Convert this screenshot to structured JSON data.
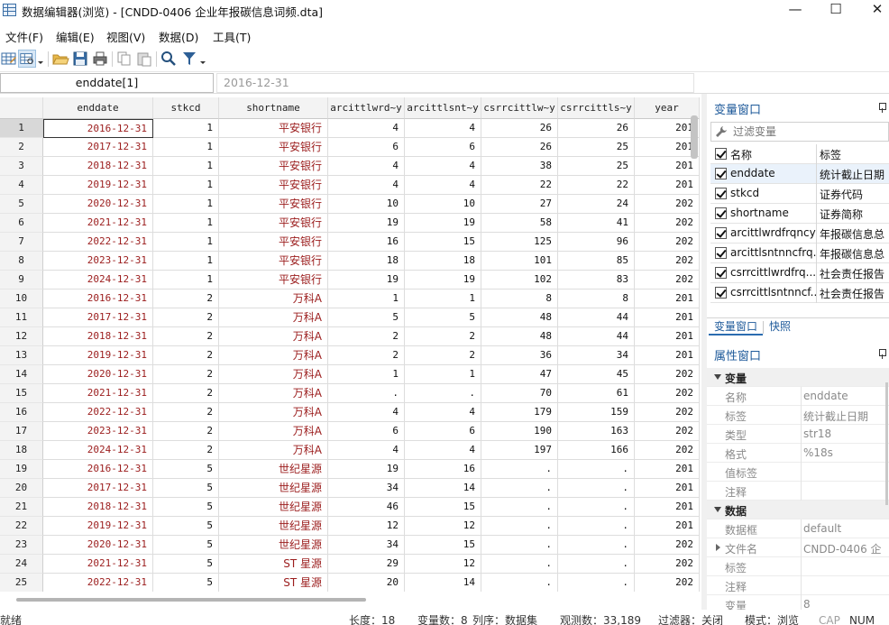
{
  "window": {
    "title": "数据编辑器(浏览) - [CNDD-0406 企业年报碳信息词频.dta]",
    "minimize": "—",
    "maximize": "☐",
    "close": "✕"
  },
  "menu": [
    "文件(F)",
    "编辑(E)",
    "视图(V)",
    "数据(D)",
    "工具(T)"
  ],
  "toolbar": {
    "icons": [
      "table-edit-icon",
      "table-browse-icon",
      "dropdown-arrow-icon",
      "open-folder-icon",
      "save-icon",
      "print-icon",
      "copy-icon",
      "paste-icon",
      "search-icon",
      "filter-icon",
      "dropdown-arrow-icon"
    ]
  },
  "cell_editor": {
    "name": "enddate[1]",
    "value": "2016-12-31"
  },
  "grid": {
    "columns": [
      "enddate",
      "stkcd",
      "shortname",
      "arcittlwrd~y",
      "arcittlsnt~y",
      "csrrcittlw~y",
      "csrrcittls~y",
      "year"
    ],
    "rows": [
      {
        "n": "1",
        "cells": [
          "2016-12-31",
          "1",
          "平安银行",
          "4",
          "4",
          "26",
          "26",
          "201"
        ]
      },
      {
        "n": "2",
        "cells": [
          "2017-12-31",
          "1",
          "平安银行",
          "6",
          "6",
          "26",
          "25",
          "201"
        ]
      },
      {
        "n": "3",
        "cells": [
          "2018-12-31",
          "1",
          "平安银行",
          "4",
          "4",
          "38",
          "25",
          "201"
        ]
      },
      {
        "n": "4",
        "cells": [
          "2019-12-31",
          "1",
          "平安银行",
          "4",
          "4",
          "22",
          "22",
          "201"
        ]
      },
      {
        "n": "5",
        "cells": [
          "2020-12-31",
          "1",
          "平安银行",
          "10",
          "10",
          "27",
          "24",
          "202"
        ]
      },
      {
        "n": "6",
        "cells": [
          "2021-12-31",
          "1",
          "平安银行",
          "19",
          "19",
          "58",
          "41",
          "202"
        ]
      },
      {
        "n": "7",
        "cells": [
          "2022-12-31",
          "1",
          "平安银行",
          "16",
          "15",
          "125",
          "96",
          "202"
        ]
      },
      {
        "n": "8",
        "cells": [
          "2023-12-31",
          "1",
          "平安银行",
          "18",
          "18",
          "101",
          "85",
          "202"
        ]
      },
      {
        "n": "9",
        "cells": [
          "2024-12-31",
          "1",
          "平安银行",
          "19",
          "19",
          "102",
          "83",
          "202"
        ]
      },
      {
        "n": "10",
        "cells": [
          "2016-12-31",
          "2",
          "万科A",
          "1",
          "1",
          "8",
          "8",
          "201"
        ]
      },
      {
        "n": "11",
        "cells": [
          "2017-12-31",
          "2",
          "万科A",
          "5",
          "5",
          "48",
          "44",
          "201"
        ]
      },
      {
        "n": "12",
        "cells": [
          "2018-12-31",
          "2",
          "万科A",
          "2",
          "2",
          "48",
          "44",
          "201"
        ]
      },
      {
        "n": "13",
        "cells": [
          "2019-12-31",
          "2",
          "万科A",
          "2",
          "2",
          "36",
          "34",
          "201"
        ]
      },
      {
        "n": "14",
        "cells": [
          "2020-12-31",
          "2",
          "万科A",
          "1",
          "1",
          "47",
          "45",
          "202"
        ]
      },
      {
        "n": "15",
        "cells": [
          "2021-12-31",
          "2",
          "万科A",
          ".",
          ".",
          "70",
          "61",
          "202"
        ]
      },
      {
        "n": "16",
        "cells": [
          "2022-12-31",
          "2",
          "万科A",
          "4",
          "4",
          "179",
          "159",
          "202"
        ]
      },
      {
        "n": "17",
        "cells": [
          "2023-12-31",
          "2",
          "万科A",
          "6",
          "6",
          "190",
          "163",
          "202"
        ]
      },
      {
        "n": "18",
        "cells": [
          "2024-12-31",
          "2",
          "万科A",
          "4",
          "4",
          "197",
          "166",
          "202"
        ]
      },
      {
        "n": "19",
        "cells": [
          "2016-12-31",
          "5",
          "世纪星源",
          "19",
          "16",
          ".",
          ".",
          "201"
        ]
      },
      {
        "n": "20",
        "cells": [
          "2017-12-31",
          "5",
          "世纪星源",
          "34",
          "14",
          ".",
          ".",
          "201"
        ]
      },
      {
        "n": "21",
        "cells": [
          "2018-12-31",
          "5",
          "世纪星源",
          "46",
          "15",
          ".",
          ".",
          "201"
        ]
      },
      {
        "n": "22",
        "cells": [
          "2019-12-31",
          "5",
          "世纪星源",
          "12",
          "12",
          ".",
          ".",
          "201"
        ]
      },
      {
        "n": "23",
        "cells": [
          "2020-12-31",
          "5",
          "世纪星源",
          "34",
          "15",
          ".",
          ".",
          "202"
        ]
      },
      {
        "n": "24",
        "cells": [
          "2021-12-31",
          "5",
          "ST 星源",
          "29",
          "12",
          ".",
          ".",
          "202"
        ]
      },
      {
        "n": "25",
        "cells": [
          "2022-12-31",
          "5",
          "ST 星源",
          "20",
          "14",
          ".",
          ".",
          "202"
        ]
      }
    ]
  },
  "variables_panel": {
    "title": "变量窗口",
    "filter_placeholder": "过滤变量",
    "header": {
      "name": "名称",
      "label": "标签"
    },
    "items": [
      {
        "name": "enddate",
        "label": "统计截止日期"
      },
      {
        "name": "stkcd",
        "label": "证券代码"
      },
      {
        "name": "shortname",
        "label": "证券简称"
      },
      {
        "name": "arcittlwrdfrqncy",
        "label": "年报碳信息总"
      },
      {
        "name": "arcittlsntnncfrq...",
        "label": "年报碳信息总"
      },
      {
        "name": "csrrcittlwrdfrq...",
        "label": "社会责任报告"
      },
      {
        "name": "csrrcittlsntnncf...",
        "label": "社会责任报告"
      }
    ],
    "tabs": [
      "变量窗口",
      "快照"
    ]
  },
  "properties_panel": {
    "title": "属性窗口",
    "sections": [
      {
        "title": "变量",
        "rows": [
          {
            "key": "名称",
            "value": "enddate"
          },
          {
            "key": "标签",
            "value": "统计截止日期"
          },
          {
            "key": "类型",
            "value": "str18"
          },
          {
            "key": "格式",
            "value": "%18s"
          },
          {
            "key": "值标签",
            "value": ""
          },
          {
            "key": "注释",
            "value": ""
          }
        ]
      },
      {
        "title": "数据",
        "rows": [
          {
            "key": "数据框",
            "value": "default"
          },
          {
            "key": "文件名",
            "value": "CNDD-0406 企"
          },
          {
            "key": "标签",
            "value": ""
          },
          {
            "key": "注释",
            "value": ""
          },
          {
            "key": "变量",
            "value": "8"
          }
        ]
      }
    ]
  },
  "status": {
    "ready": "就绪",
    "width": "长度：18",
    "vars": "变量数：8",
    "order": "列序：数据集",
    "obs": "观测数：33,189",
    "filter": "过滤器：关闭",
    "mode": "模式：浏览",
    "cap": "CAP",
    "num": "NUM"
  },
  "colors": {
    "string_text": "#9b1c1c",
    "panel_title": "#1e5a9a",
    "header_bg": "#f3f3f3"
  }
}
